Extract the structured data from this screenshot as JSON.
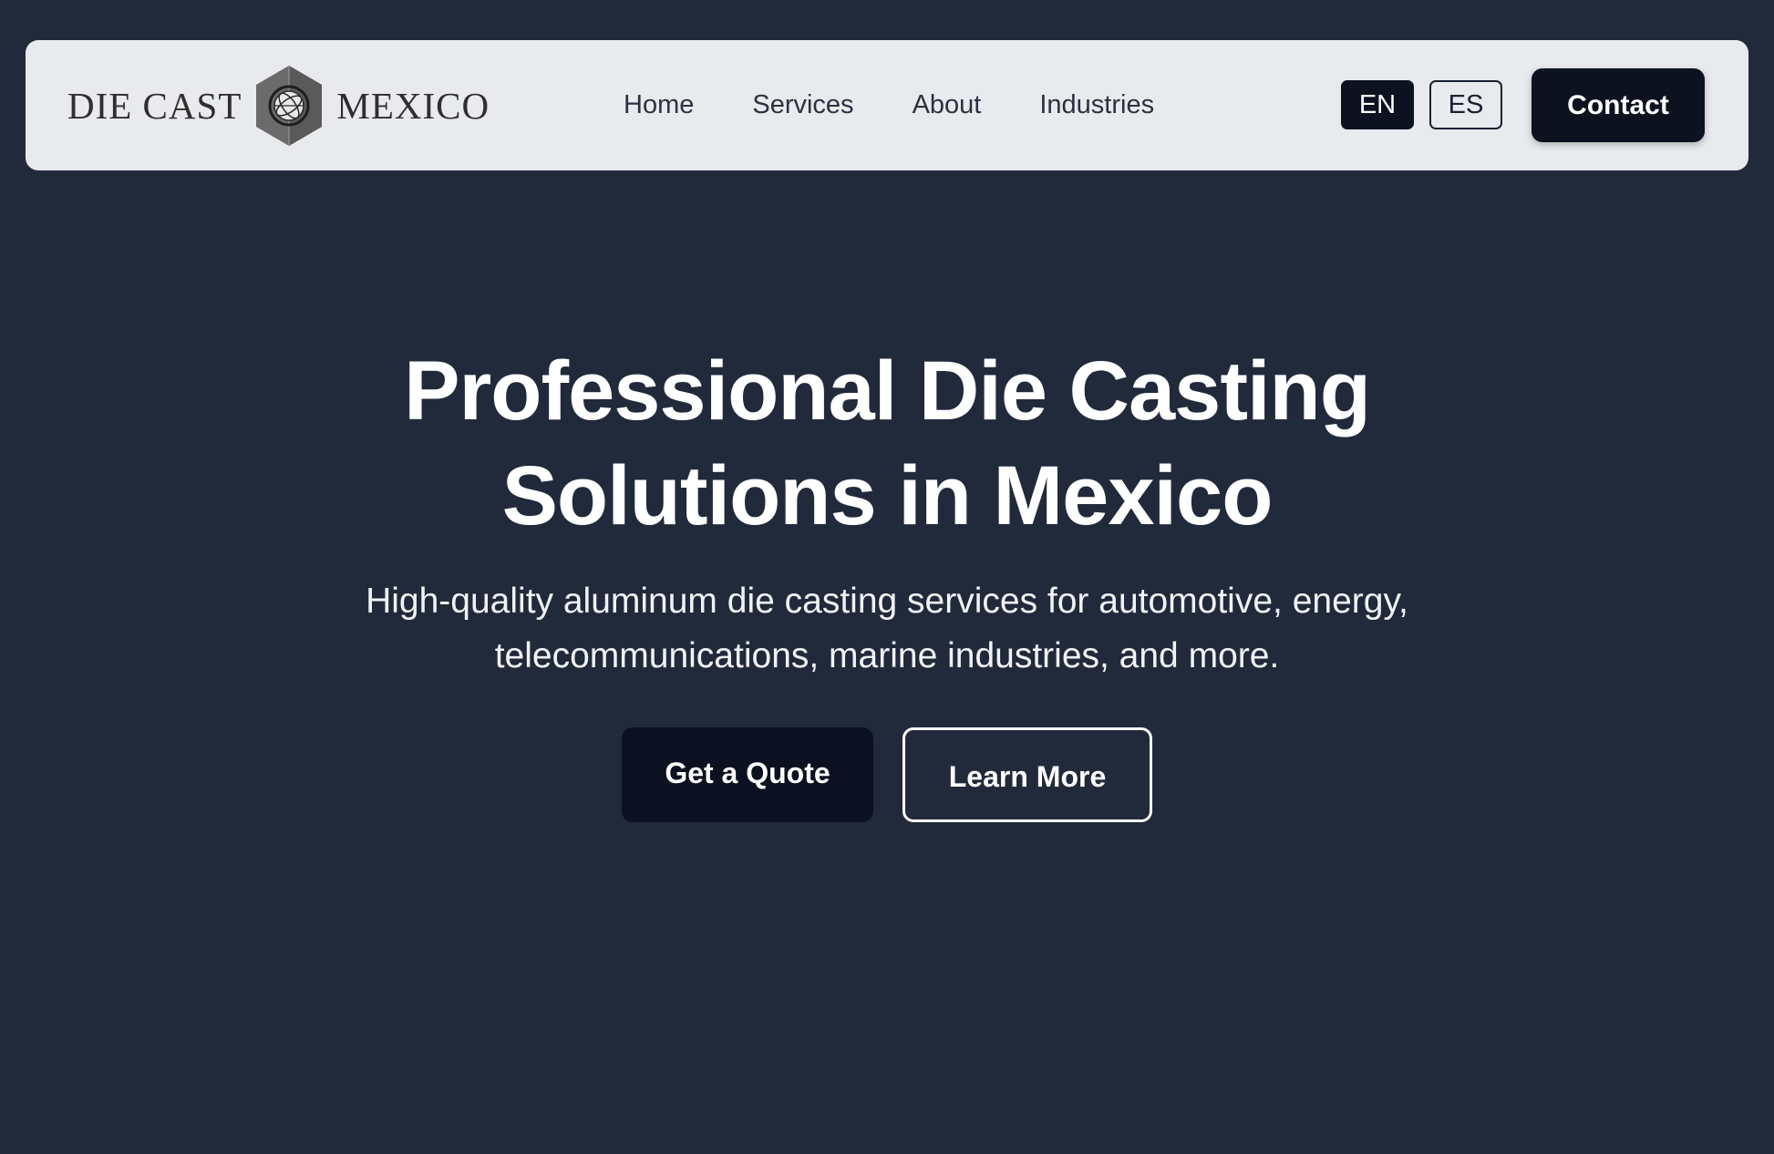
{
  "nav": {
    "logo": {
      "left_text": "DIE CAST",
      "right_text": "MEXICO",
      "icon": "hexagon-globe-icon"
    },
    "links": [
      {
        "label": "Home"
      },
      {
        "label": "Services"
      },
      {
        "label": "About"
      },
      {
        "label": "Industries"
      }
    ],
    "languages": {
      "en": "EN",
      "es": "ES",
      "selected": "EN"
    },
    "contact_label": "Contact"
  },
  "hero": {
    "title_line1": "Professional Die Casting",
    "title_line2": "Solutions in Mexico",
    "subtitle_line1": "High-quality aluminum die casting services for automotive, energy,",
    "subtitle_line2": "telecommunications, marine industries, and more.",
    "primary_cta": "Get a Quote",
    "secondary_cta": "Learn More"
  },
  "colors": {
    "page_background": "#212a3b",
    "navbar_background": "#e8eaed",
    "dark_button": "#0c1220",
    "text_light": "#ffffff"
  }
}
